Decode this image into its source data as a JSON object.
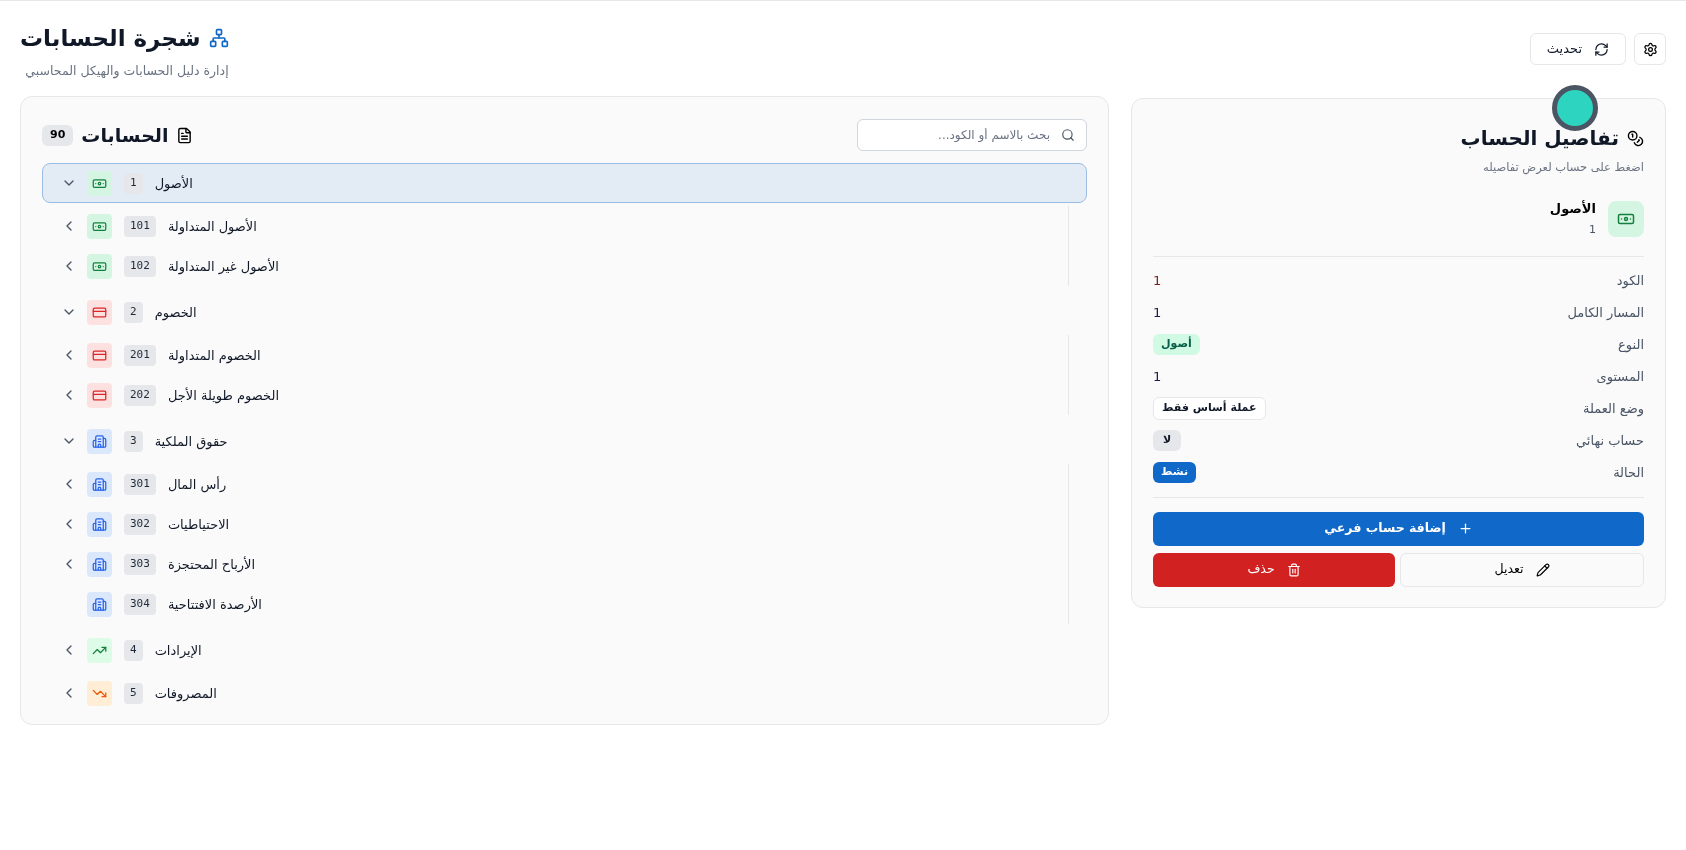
{
  "header": {
    "title": "شجرة الحسابات",
    "subtitle": "إدارة دليل الحسابات والهيكل المحاسبي",
    "refresh_button": "تحديث"
  },
  "tree_panel": {
    "title": "الحسابات",
    "count": "90",
    "search": {
      "placeholder": "بحث بالاسم أو الكود..."
    },
    "items": [
      {
        "kind": "money",
        "name": "الأصول",
        "code": "1",
        "selected": true,
        "expanded": true,
        "leaf": false,
        "children": [
          {
            "name": "الأصول المتداولة",
            "code": "101",
            "selected": false,
            "expanded": false,
            "leaf": false
          },
          {
            "name": "الأصول غير المتداولة",
            "code": "102",
            "selected": false,
            "expanded": false,
            "leaf": false
          }
        ]
      },
      {
        "kind": "card",
        "name": "الخصوم",
        "code": "2",
        "selected": false,
        "expanded": true,
        "leaf": false,
        "children": [
          {
            "name": "الخصوم المتداولة",
            "code": "201",
            "selected": false,
            "expanded": false,
            "leaf": false
          },
          {
            "name": "الخصوم طويلة الأجل",
            "code": "202",
            "selected": false,
            "expanded": false,
            "leaf": false
          }
        ]
      },
      {
        "kind": "building",
        "name": "حقوق الملكية",
        "code": "3",
        "selected": false,
        "expanded": true,
        "leaf": false,
        "children": [
          {
            "name": "رأس المال",
            "code": "301",
            "selected": false,
            "expanded": false,
            "leaf": false
          },
          {
            "name": "الاحتياطيات",
            "code": "302",
            "selected": false,
            "expanded": false,
            "leaf": false
          },
          {
            "name": "الأرباح المحتجزة",
            "code": "303",
            "selected": false,
            "expanded": false,
            "leaf": false
          },
          {
            "name": "الأرصدة الافتتاحية",
            "code": "304",
            "selected": false,
            "leaf": true
          }
        ]
      },
      {
        "kind": "trend-up",
        "name": "الإيرادات",
        "code": "4",
        "selected": false,
        "expanded": false,
        "leaf": false
      },
      {
        "kind": "trend-down",
        "name": "المصروفات",
        "code": "5",
        "selected": false,
        "expanded": false,
        "leaf": false
      }
    ]
  },
  "details_panel": {
    "title": "تفاصيل الحساب",
    "subtitle": "اضغط على حساب لعرض تفاصيله",
    "account": {
      "kind": "money",
      "name": "الأصول",
      "code": "1"
    },
    "fields": [
      {
        "label": "الكود",
        "kind": "code",
        "value": "1"
      },
      {
        "label": "المسار الكامل",
        "kind": "text",
        "value": "1"
      },
      {
        "label": "النوع",
        "kind": "type-badge",
        "value": "أصول"
      },
      {
        "label": "المستوى",
        "kind": "text",
        "value": "1"
      },
      {
        "label": "وضع العملة",
        "kind": "outline-badge",
        "value": "عملة أساس فقط"
      },
      {
        "label": "حساب نهائي",
        "kind": "gray-badge",
        "value": "لا"
      },
      {
        "label": "الحالة",
        "kind": "status-badge",
        "value": "نشط"
      }
    ],
    "add_button": "إضافة حساب فرعي",
    "edit_button": "تعديل",
    "delete_button": "حذف"
  }
}
